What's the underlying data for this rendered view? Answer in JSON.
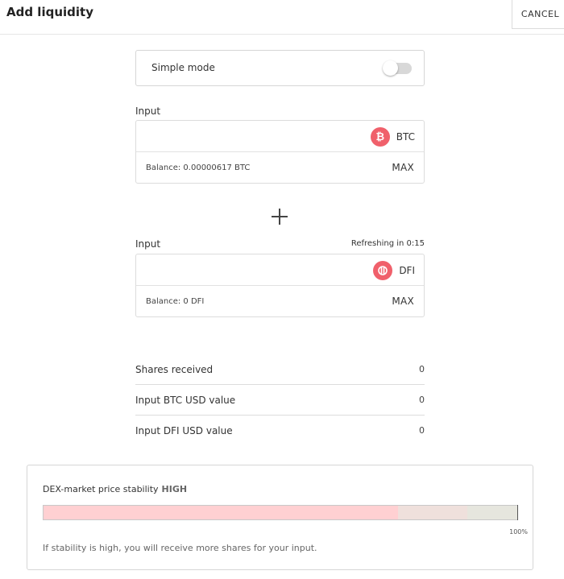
{
  "header": {
    "title": "Add liquidity",
    "cancel_label": "CANCEL"
  },
  "simple_mode": {
    "label": "Simple mode",
    "enabled": false
  },
  "input_a": {
    "label": "Input",
    "value": "",
    "token": "BTC",
    "token_icon": "bitcoin-icon",
    "balance": "Balance: 0.00000617 BTC",
    "max_label": "MAX"
  },
  "input_b": {
    "label": "Input",
    "refresh_text": "Refreshing in 0:15",
    "value": "",
    "token": "DFI",
    "token_icon": "defichain-icon",
    "balance": "Balance: 0 DFI",
    "max_label": "MAX"
  },
  "stats": [
    {
      "label": "Shares received",
      "value": "0"
    },
    {
      "label": "Input BTC USD value",
      "value": "0"
    },
    {
      "label": "Input DFI USD value",
      "value": "0"
    }
  ],
  "stability": {
    "title": "DEX-market price stability",
    "level": "HIGH",
    "bar_segments": [
      {
        "name": "high",
        "fraction": 0.749,
        "color": "#ffd0d2"
      },
      {
        "name": "medium",
        "fraction": 0.146,
        "color": "#efe0dc"
      },
      {
        "name": "low",
        "fraction": 0.105,
        "color": "#e6e6de"
      }
    ],
    "percent_label": "100%",
    "hint": "If stability is high, you will receive more shares for your input."
  },
  "colors": {
    "token_accent": "#f0606b"
  }
}
